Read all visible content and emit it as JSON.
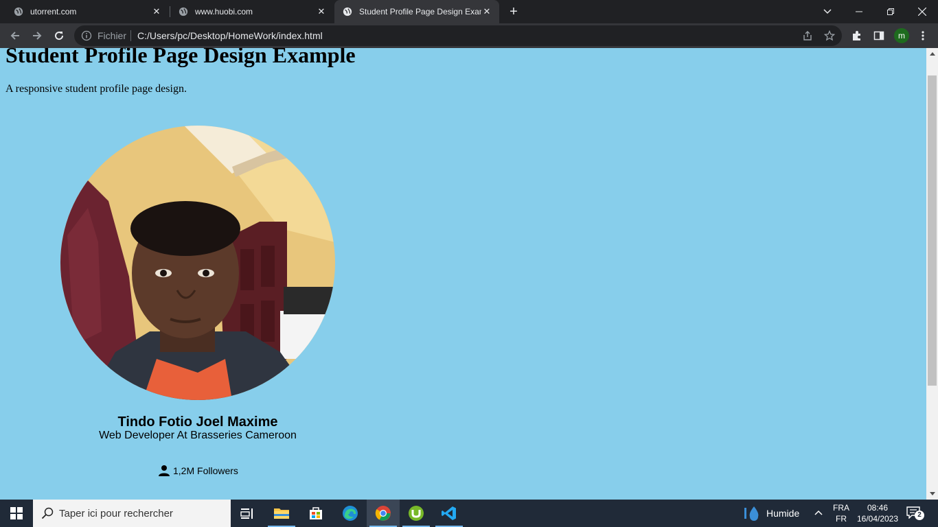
{
  "browser": {
    "tabs": [
      {
        "title": "utorrent.com",
        "active": false
      },
      {
        "title": "www.huobi.com",
        "active": false
      },
      {
        "title": "Student Profile Page Design Example",
        "active": true
      }
    ],
    "address_bar": {
      "scheme_label": "Fichier",
      "url": "C:/Users/pc/Desktop/HomeWork/index.html"
    },
    "profile_initial": "m"
  },
  "page": {
    "heading": "Student Profile Page Design Example",
    "subtitle": "A responsive student profile page design.",
    "profile": {
      "name": "Tindo Fotio Joel Maxime",
      "role": "Web Developer At Brasseries Cameroon",
      "followers": "1,2M Followers"
    }
  },
  "taskbar": {
    "search_placeholder": "Taper ici pour rechercher",
    "weather": "Humide",
    "language": {
      "line1": "FRA",
      "line2": "FR"
    },
    "clock": {
      "time": "08:46",
      "date": "16/04/2023"
    },
    "notification_count": "2"
  },
  "colors": {
    "page_background": "#87ceeb",
    "browser_dark": "#202124",
    "toolbar": "#35363a",
    "taskbar": "#202a38"
  }
}
